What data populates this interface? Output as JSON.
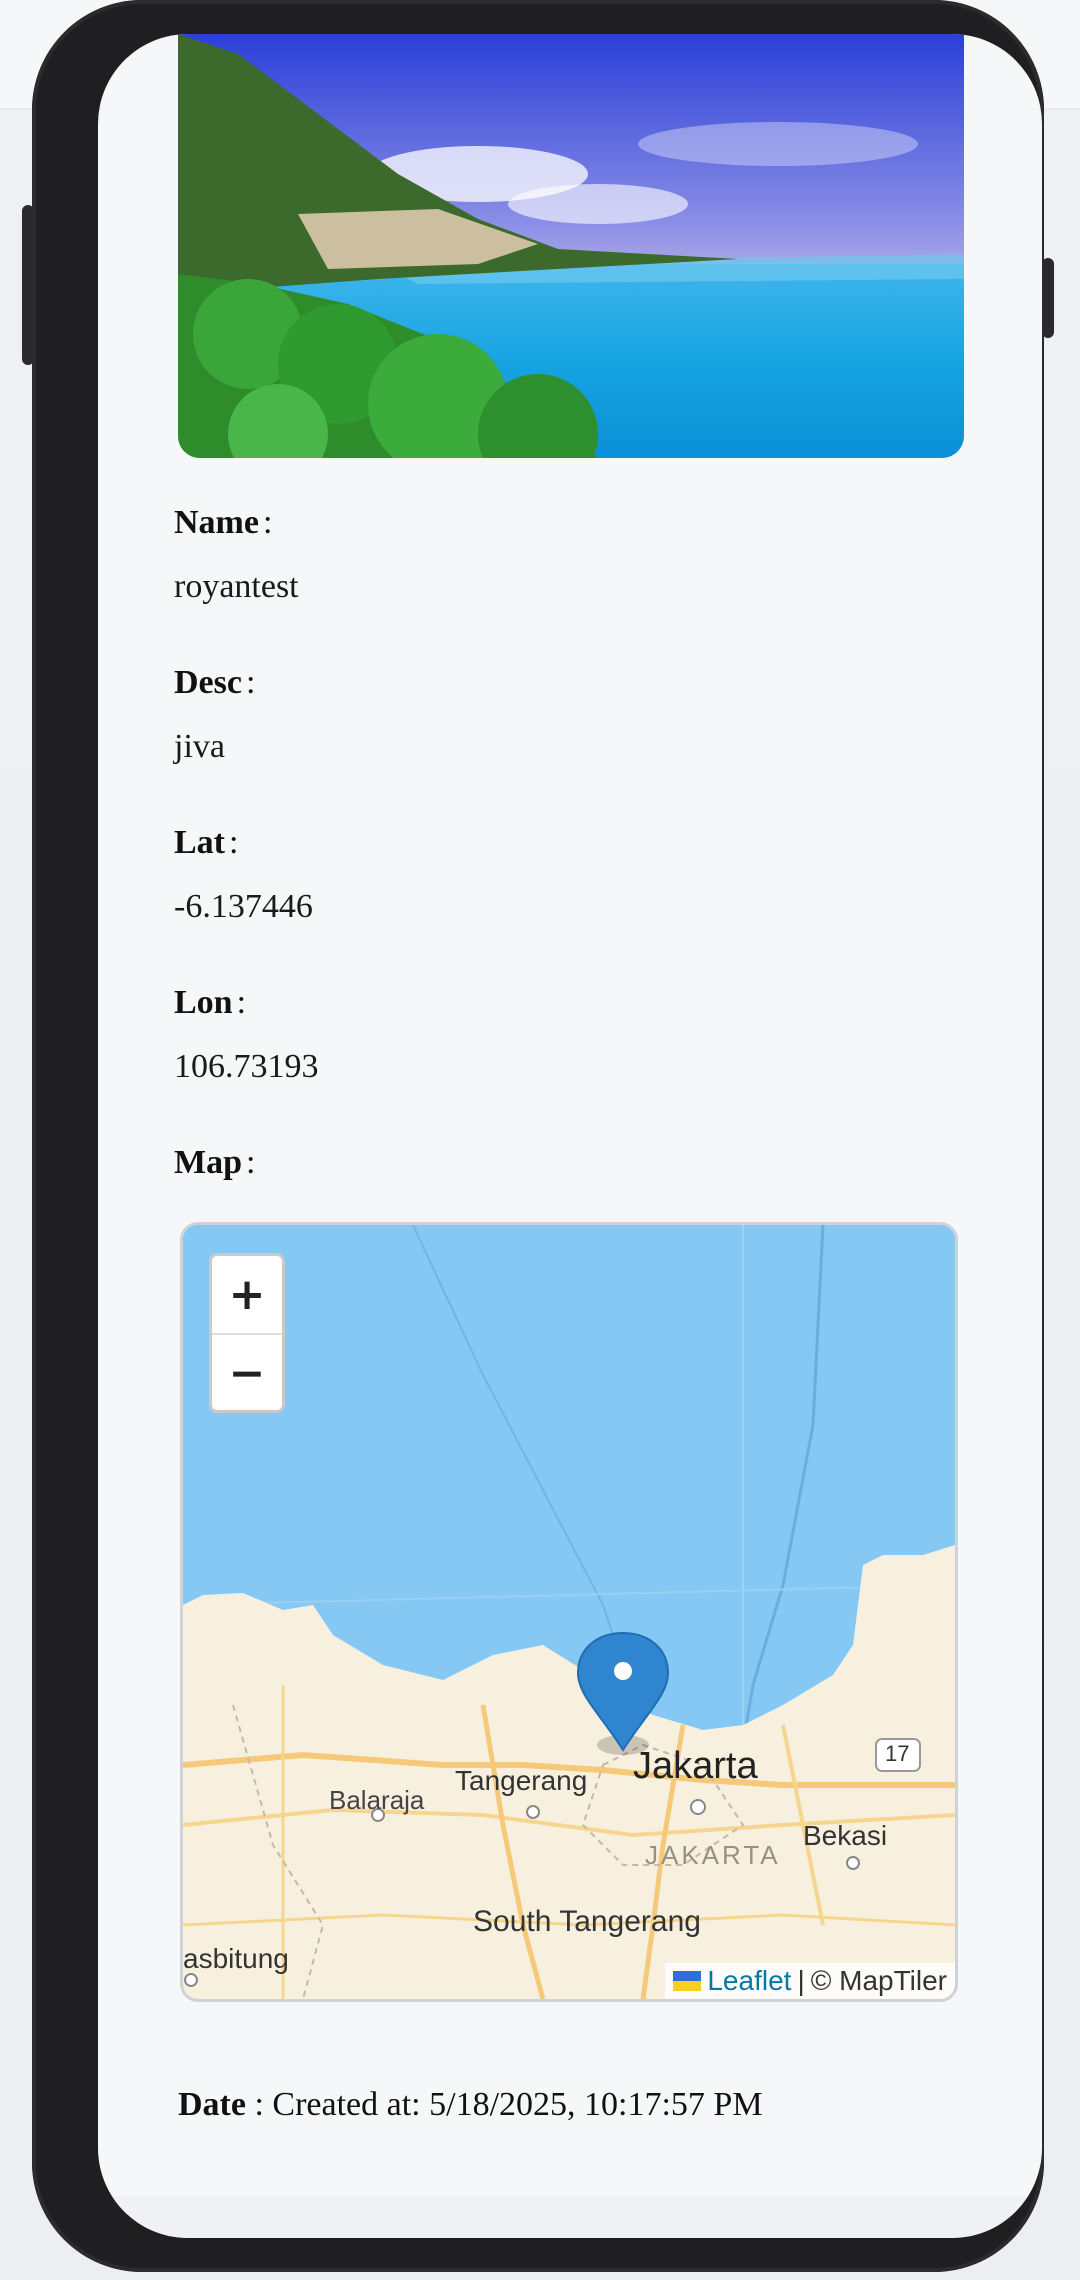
{
  "record": {
    "name_label": "Name",
    "name_value": "royantest",
    "desc_label": "Desc",
    "desc_value": "jiva",
    "lat_label": "Lat",
    "lat_value": "-6.137446",
    "lon_label": "Lon",
    "lon_value": "106.73193",
    "map_label": "Map",
    "date_label": "Date",
    "date_value": "Created at: 5/18/2025, 10:17:57 PM",
    "colon": ":"
  },
  "map": {
    "zoom_in": "+",
    "zoom_out": "−",
    "place_labels": {
      "jakarta": "Jakarta",
      "jakarta_region": "JAKARTA",
      "tangerang": "Tangerang",
      "south_tangerang": "South Tangerang",
      "balaraja": "Balaraja",
      "bekasi": "Bekasi",
      "rangkasbitung": "asbitung",
      "road_shield": "17"
    },
    "attribution_link": "Leaflet",
    "attribution_separator": "|",
    "attribution_text": "© MapTiler",
    "water_color": "#85c8f3",
    "land_color": "#f7f0df"
  }
}
